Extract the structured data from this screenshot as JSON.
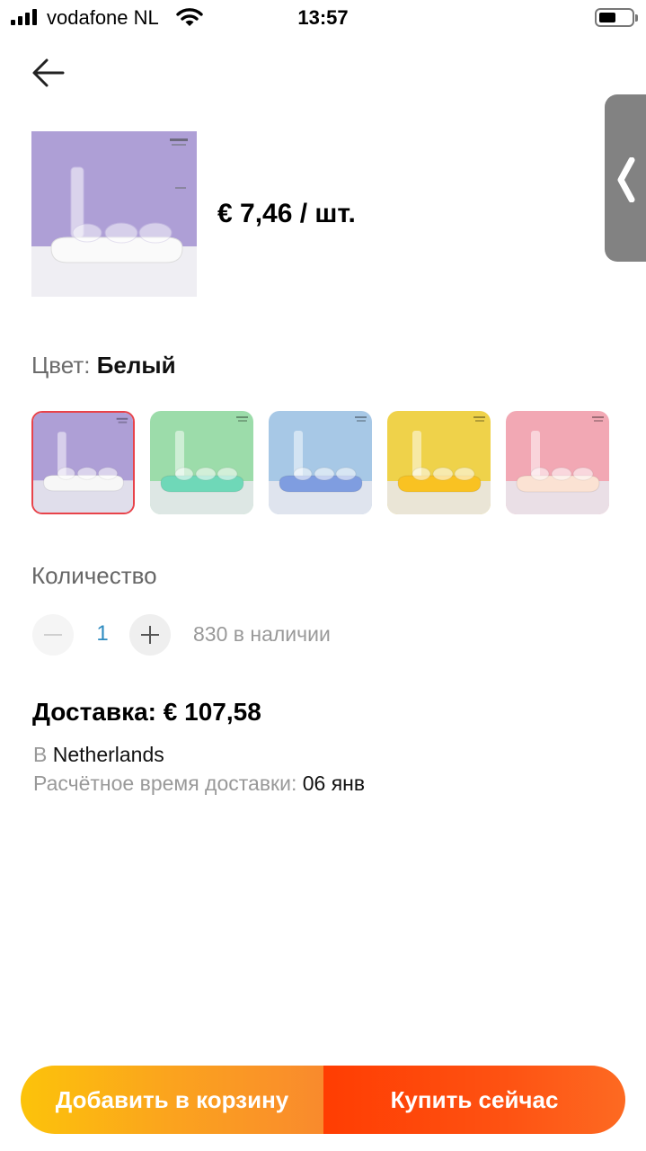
{
  "status_bar": {
    "carrier": "vodafone NL",
    "time": "13:57"
  },
  "product": {
    "price": "€ 7,46 / шт.",
    "color_label": "Цвет: ",
    "color_value": "Белый",
    "swatches": [
      {
        "name": "white",
        "bg": "#ae9fd6",
        "base": "#f7f7f7",
        "selected": true
      },
      {
        "name": "green",
        "bg": "#9cdcaa",
        "base": "#6fd8b8",
        "selected": false
      },
      {
        "name": "blue",
        "bg": "#a7c8e6",
        "base": "#7f9de0",
        "selected": false
      },
      {
        "name": "yellow",
        "bg": "#efd24a",
        "base": "#f9c222",
        "selected": false
      },
      {
        "name": "pink",
        "bg": "#f2a8b4",
        "base": "#fbe2d3",
        "selected": false
      }
    ]
  },
  "quantity": {
    "label": "Количество",
    "value": "1",
    "stock": "830 в наличии"
  },
  "shipping": {
    "title": "Доставка: € 107,58",
    "dest_label": "В ",
    "dest_value": "Netherlands",
    "time_label": "Расчётное время доставки: ",
    "time_value": "06 янв"
  },
  "actions": {
    "add_to_cart": "Добавить в корзину",
    "buy_now": "Купить сейчас"
  },
  "colors": {
    "accent_red": "#e8434a",
    "qty_blue": "#2e8bc0",
    "cart_gradient_start": "#fcc30a",
    "buy_gradient_start": "#ff3d02"
  }
}
